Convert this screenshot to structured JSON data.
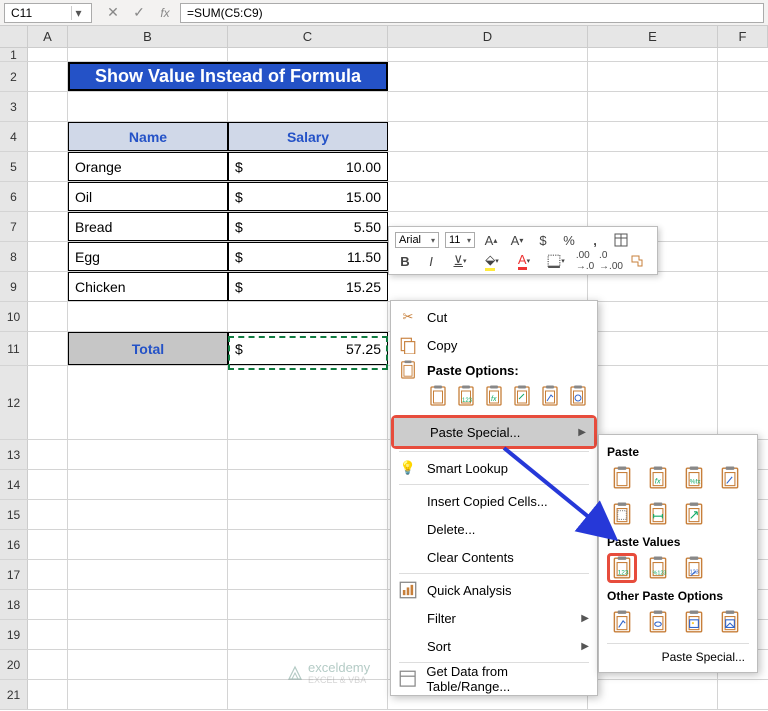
{
  "namebox": "C11",
  "formula": "=SUM(C5:C9)",
  "columns": [
    "A",
    "B",
    "C",
    "D",
    "E",
    "F"
  ],
  "title": "Show Value Instead of Formula",
  "headers": {
    "name": "Name",
    "salary": "Salary"
  },
  "rows": [
    {
      "name": "Orange",
      "salary": "10.00"
    },
    {
      "name": "Oil",
      "salary": "15.00"
    },
    {
      "name": "Bread",
      "salary": "5.50"
    },
    {
      "name": "Egg",
      "salary": "11.50"
    },
    {
      "name": "Chicken",
      "salary": "15.25"
    }
  ],
  "total_label": "Total",
  "total_value": "57.25",
  "currency": "$",
  "mini_toolbar": {
    "font": "Arial",
    "size": "11"
  },
  "context_menu": {
    "cut": "Cut",
    "copy": "Copy",
    "paste_options": "Paste Options:",
    "paste_special": "Paste Special...",
    "smart_lookup": "Smart Lookup",
    "insert_copied": "Insert Copied Cells...",
    "delete": "Delete...",
    "clear": "Clear Contents",
    "quick_analysis": "Quick Analysis",
    "filter": "Filter",
    "sort": "Sort",
    "get_data": "Get Data from Table/Range..."
  },
  "submenu": {
    "paste": "Paste",
    "paste_values": "Paste Values",
    "other": "Other Paste Options",
    "paste_special": "Paste Special..."
  },
  "watermark": {
    "main": "exceldemy",
    "sub": "EXCEL & VBA"
  }
}
